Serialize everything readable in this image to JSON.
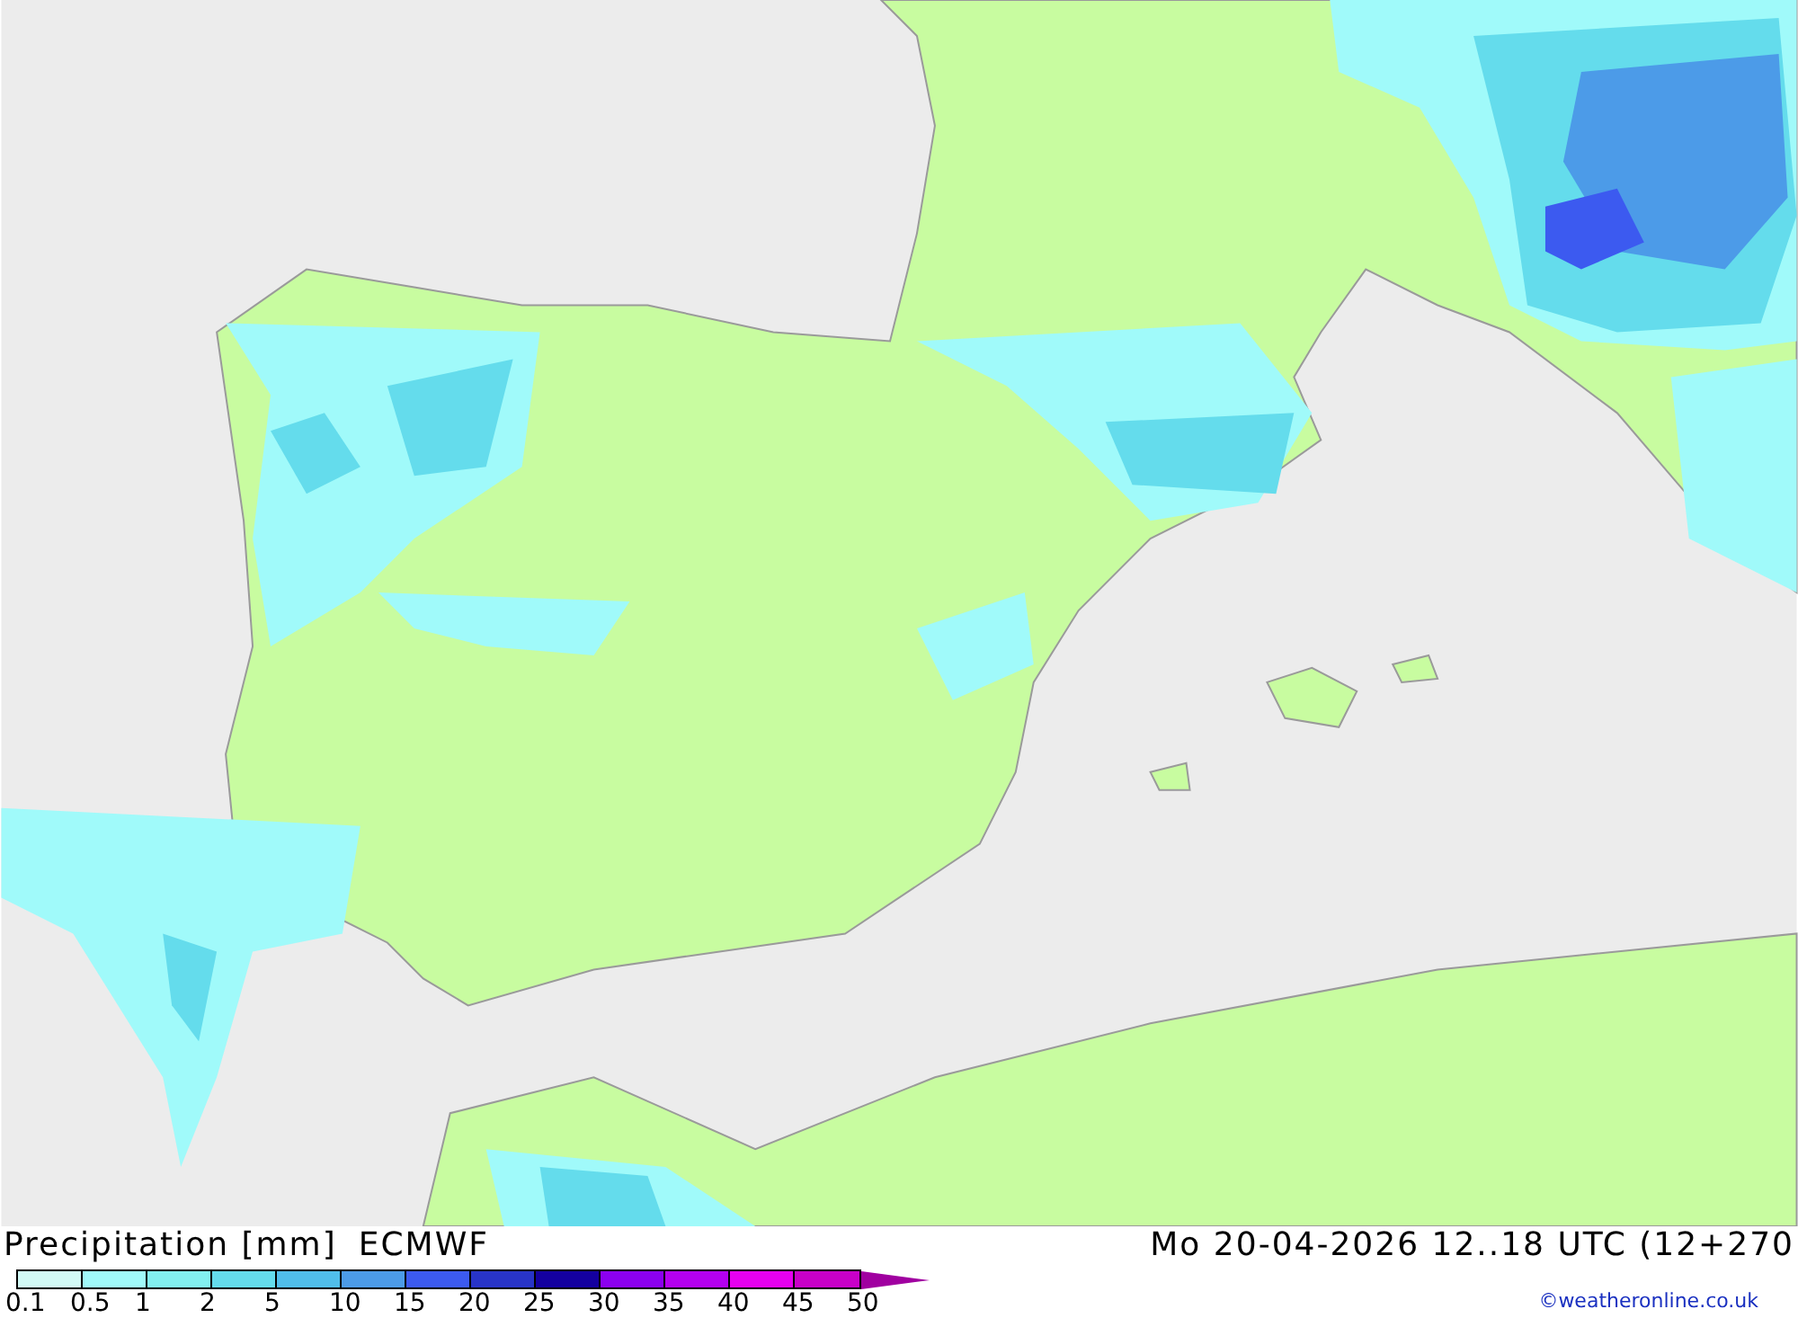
{
  "title": "Precipitation [mm]",
  "model": "ECMWF",
  "valid_time": "Mo 20-04-2026 12..18 UTC (12+270",
  "legend": {
    "bins": [
      {
        "color": "#d2faf6"
      },
      {
        "color": "#a0fafa"
      },
      {
        "color": "#82f0f0"
      },
      {
        "color": "#64dcec"
      },
      {
        "color": "#50beea"
      },
      {
        "color": "#4c9be8"
      },
      {
        "color": "#3c5af0"
      },
      {
        "color": "#2834c8"
      },
      {
        "color": "#1400a0"
      },
      {
        "color": "#8c00f0"
      },
      {
        "color": "#b400f0"
      },
      {
        "color": "#e600f0"
      },
      {
        "color": "#c800c8"
      },
      {
        "kind": "arrow",
        "color": "#a000a0"
      }
    ],
    "ticks": [
      "0.1",
      "0.5",
      "1",
      "2",
      "5",
      "10",
      "15",
      "20",
      "25",
      "30",
      "35",
      "40",
      "45",
      "50"
    ]
  },
  "credit": "©weatheronline.co.uk"
}
